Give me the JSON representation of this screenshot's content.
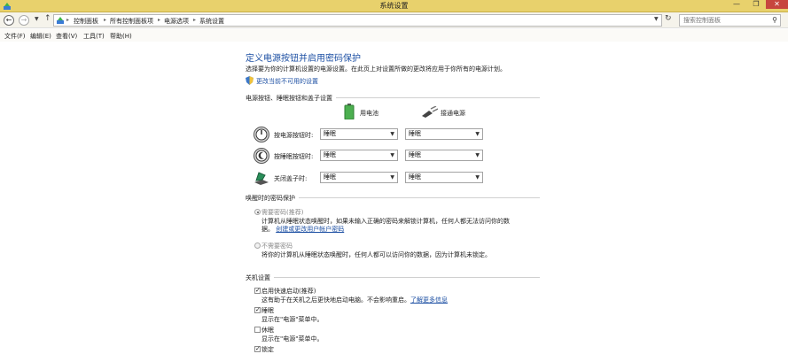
{
  "window": {
    "title": "系统设置",
    "minimize": "—",
    "maximize": "❐",
    "close": "✕"
  },
  "address": {
    "crumbs": [
      "控制面板",
      "所有控制面板项",
      "电源选项",
      "系统设置"
    ],
    "search_placeholder": "搜索控制面板"
  },
  "menu": [
    "文件(F)",
    "编辑(E)",
    "查看(V)",
    "工具(T)",
    "帮助(H)"
  ],
  "page": {
    "title": "定义电源按钮并启用密码保护",
    "description": "选择要为你的计算机设置的电源设置。在此页上对设置所做的更改将应用于你所有的电源计划。",
    "change_link": "更改当前不可用的设置"
  },
  "power_buttons": {
    "group_label": "电源按钮、睡眠按钮和盖子设置",
    "col_battery": "用电池",
    "col_plugged": "接通电源",
    "rows": [
      {
        "label": "按电源按钮时:",
        "battery": "睡眠",
        "plugged": "睡眠"
      },
      {
        "label": "按睡眠按钮时:",
        "battery": "睡眠",
        "plugged": "睡眠"
      },
      {
        "label": "关闭盖子时:",
        "battery": "睡眠",
        "plugged": "睡眠"
      }
    ]
  },
  "password": {
    "group_label": "唤醒时的密码保护",
    "option1_label": "需要密码(推荐)",
    "option1_desc": "计算机从睡眠状态唤醒时，如果未输入正确的密码来解锁计算机，任何人都无法访问你的数",
    "option1_desc2": "据。",
    "option1_link": "创建或更改用户帐户密码",
    "option2_label": "不需要密码",
    "option2_desc": "将你的计算机从睡眠状态唤醒时，任何人都可以访问你的数据，因为计算机未锁定。"
  },
  "shutdown": {
    "group_label": "关机设置",
    "items": [
      {
        "label": "启用快速启动(推荐)",
        "checked": true,
        "desc": "这有助于在关机之后更快地启动电脑。不会影响重启。",
        "link": "了解更多信息"
      },
      {
        "label": "睡眠",
        "checked": true,
        "desc": "显示在\"电源\"菜单中。"
      },
      {
        "label": "休眠",
        "checked": false,
        "desc": "显示在\"电源\"菜单中。"
      },
      {
        "label": "锁定",
        "checked": true
      }
    ],
    "check_mark": "✓"
  }
}
